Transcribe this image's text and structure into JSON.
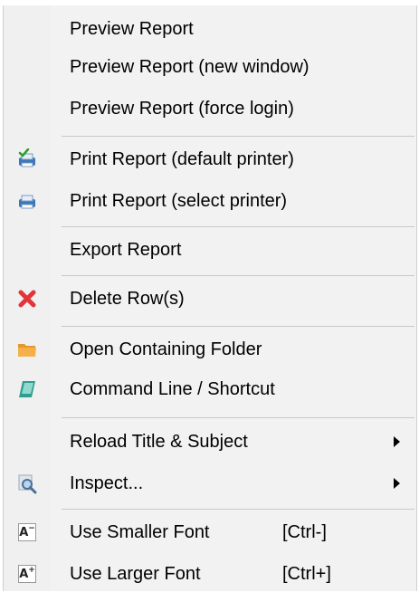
{
  "menu": {
    "items": [
      {
        "label": "Preview Report",
        "icon": ""
      },
      {
        "label": "Preview Report (new window)",
        "icon": ""
      },
      {
        "label": "Preview Report (force login)",
        "icon": ""
      },
      {
        "label": "Print Report (default printer)",
        "icon": "printer-check-icon"
      },
      {
        "label": "Print Report (select printer)",
        "icon": "printer-icon"
      },
      {
        "label": "Export Report",
        "icon": ""
      },
      {
        "label": "Delete Row(s)",
        "icon": "delete-x-icon"
      },
      {
        "label": "Open Containing Folder",
        "icon": "folder-icon"
      },
      {
        "label": "Command Line / Shortcut",
        "icon": "command-line-icon"
      },
      {
        "label": "Reload Title & Subject",
        "icon": "",
        "submenu": true
      },
      {
        "label": "Inspect...",
        "icon": "magnifier-icon",
        "submenu": true
      },
      {
        "label": "Use Smaller Font",
        "icon": "font-smaller-icon",
        "shortcut": "[Ctrl-]"
      },
      {
        "label": "Use Larger Font",
        "icon": "font-larger-icon",
        "shortcut": "[Ctrl+]"
      }
    ],
    "font_smaller_glyph": "A",
    "font_smaller_mark": "−",
    "font_larger_glyph": "A",
    "font_larger_mark": "+"
  },
  "colors": {
    "menu_bg": "#f2f2f2",
    "separator": "#c8c8c8",
    "delete_red": "#e0363b",
    "folder_orange": "#e8962e",
    "printer_blue": "#3a77b8"
  }
}
